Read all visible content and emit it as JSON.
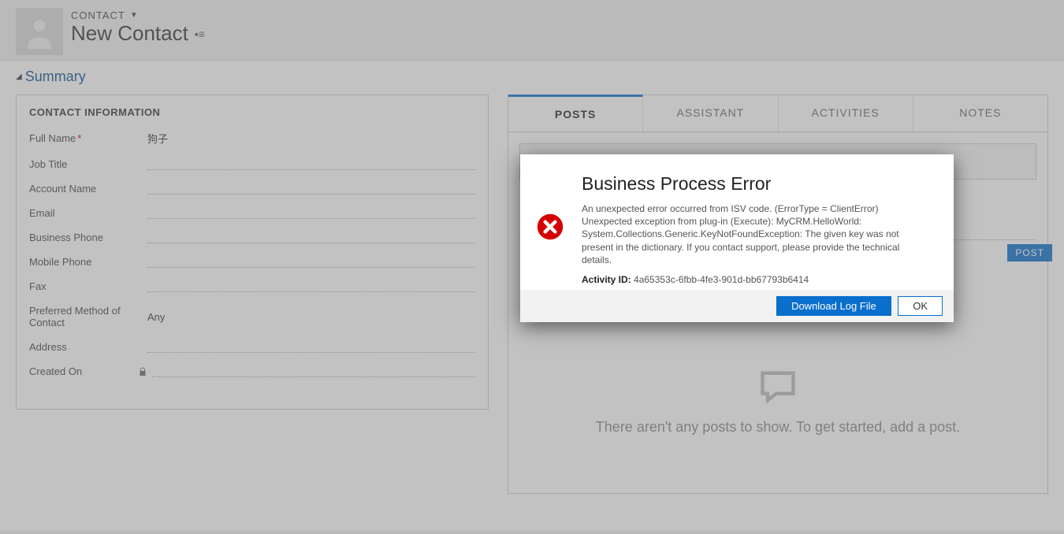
{
  "header": {
    "entity_label": "CONTACT",
    "record_title": "New Contact"
  },
  "section": {
    "title": "Summary"
  },
  "card": {
    "title": "CONTACT INFORMATION",
    "fields": {
      "full_name_label": "Full Name",
      "full_name_value": "狗子",
      "job_title_label": "Job Title",
      "account_name_label": "Account Name",
      "email_label": "Email",
      "business_phone_label": "Business Phone",
      "mobile_phone_label": "Mobile Phone",
      "fax_label": "Fax",
      "preferred_method_label": "Preferred Method of Contact",
      "preferred_method_value": "Any",
      "address_label": "Address",
      "created_on_label": "Created On"
    }
  },
  "tabs": {
    "posts": "POSTS",
    "assistant": "ASSISTANT",
    "activities": "ACTIVITIES",
    "notes": "NOTES"
  },
  "posts_panel": {
    "post_button": "POST",
    "empty_state": "There aren't any posts to show. To get started, add a post."
  },
  "dialog": {
    "title": "Business Process Error",
    "message": "An unexpected error occurred from ISV code. (ErrorType = ClientError) Unexpected exception from plug-in (Execute): MyCRM.HelloWorld: System.Collections.Generic.KeyNotFoundException: The given key was not present in the dictionary. If you contact support, please provide the technical details.",
    "activity_label": "Activity ID:",
    "activity_id": "4a65353c-6fbb-4fe3-901d-bb67793b6414",
    "download_btn": "Download Log File",
    "ok_btn": "OK"
  }
}
